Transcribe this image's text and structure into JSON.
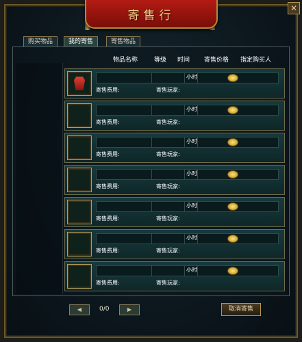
{
  "window": {
    "title": "寄售行",
    "close_label": "✕"
  },
  "tabs": [
    {
      "label": "购买物品",
      "active": false
    },
    {
      "label": "我的寄售",
      "active": true
    },
    {
      "label": "寄售物品",
      "active": false
    }
  ],
  "headers": [
    "物品名称",
    "等级",
    "时间",
    "寄售价格",
    "指定购买人"
  ],
  "rows": [
    {
      "item_icon": "red-armor-icon",
      "hours_label": "小时",
      "fee_label": "寄售费用:",
      "player_label": "寄售玩家:"
    },
    {
      "item_icon": "",
      "hours_label": "小时",
      "fee_label": "寄售费用:",
      "player_label": "寄售玩家:"
    },
    {
      "item_icon": "",
      "hours_label": "小时",
      "fee_label": "寄售费用:",
      "player_label": "寄售玩家:"
    },
    {
      "item_icon": "",
      "hours_label": "小时",
      "fee_label": "寄售费用:",
      "player_label": "寄售玩家:"
    },
    {
      "item_icon": "",
      "hours_label": "小时",
      "fee_label": "寄售费用:",
      "player_label": "寄售玩家:"
    },
    {
      "item_icon": "",
      "hours_label": "小时",
      "fee_label": "寄售费用:",
      "player_label": "寄售玩家:"
    },
    {
      "item_icon": "",
      "hours_label": "小时",
      "fee_label": "寄售费用:",
      "player_label": "寄售玩家:"
    }
  ],
  "pagination": {
    "prev_label": "◀",
    "next_label": "▶",
    "page_label": "0/0"
  },
  "actions": {
    "cancel_label": "取消寄售"
  }
}
